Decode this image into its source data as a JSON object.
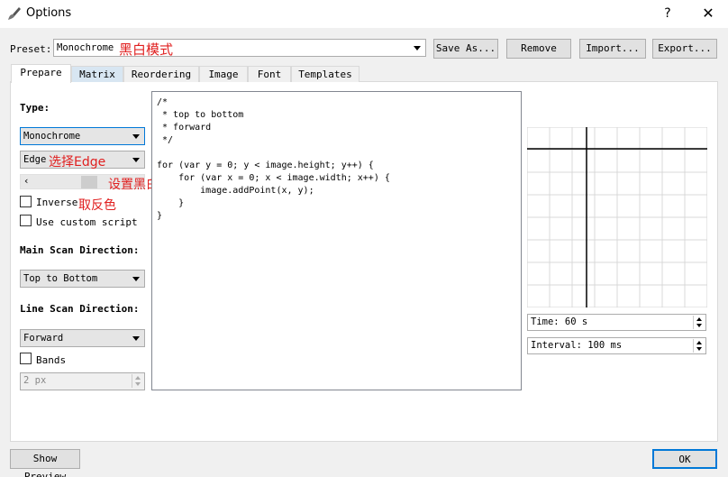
{
  "window": {
    "title": "Options",
    "help": "?",
    "close": "✕"
  },
  "preset": {
    "label": "Preset:",
    "value": "Monochrome",
    "annotation": "黑白模式",
    "buttons": {
      "save_as": "Save As...",
      "remove": "Remove",
      "import": "Import...",
      "export": "Export..."
    }
  },
  "tabs": [
    "Prepare",
    "Matrix",
    "Reordering",
    "Image",
    "Font",
    "Templates"
  ],
  "prepare": {
    "type_label": "Type:",
    "type_value": "Monochrome",
    "edge_value": "Edge",
    "edge_annotation": "选择Edge",
    "threshold_annotation": "设置黑白临界值",
    "inverse_label": "Inverse",
    "inverse_annotation": "取反色",
    "custom_script_label": "Use custom script",
    "main_scan_label": "Main Scan Direction:",
    "main_scan_value": "Top to Bottom",
    "line_scan_label": "Line Scan Direction:",
    "line_scan_value": "Forward",
    "bands_label": "Bands",
    "bands_width": "2 px"
  },
  "script": "/*\n * top to bottom\n * forward\n */\n\nfor (var y = 0; y < image.height; y++) {\n    for (var x = 0; x < image.width; x++) {\n        image.addPoint(x, y);\n    }\n}",
  "preview": {
    "time": "Time: 60 s",
    "interval": "Interval: 100 ms"
  },
  "footer": {
    "show_preview": "Show Preview",
    "ok": "OK"
  },
  "colors": {
    "accent": "#0078d7",
    "annotation": "#e02020"
  }
}
